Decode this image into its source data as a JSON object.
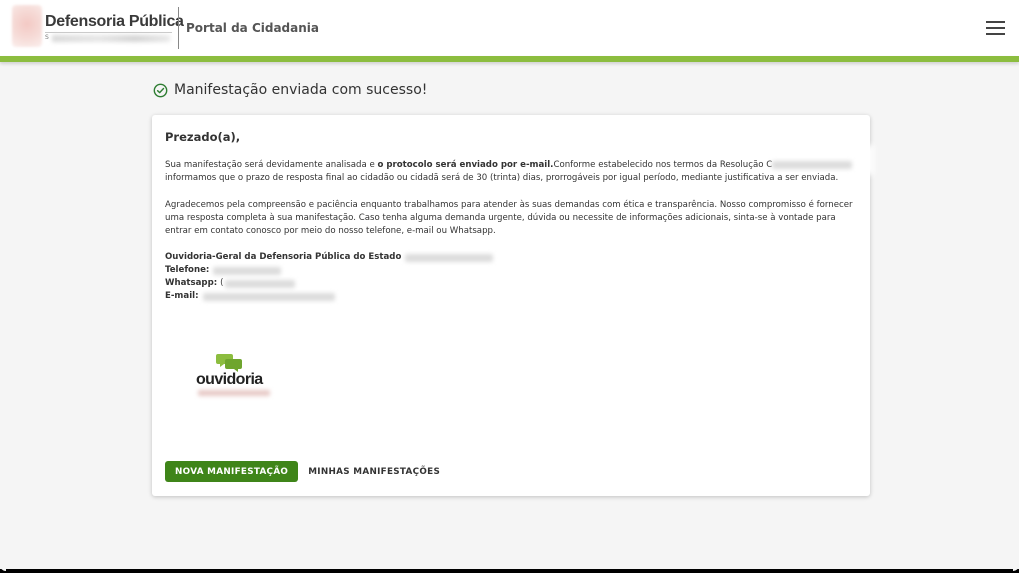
{
  "header": {
    "brand_name": "Defensoria Pública",
    "brand_sub": "S",
    "portal_title": "Portal da Cidadania"
  },
  "status": {
    "success_message": "Manifestação enviada com sucesso!"
  },
  "card": {
    "greeting": "Prezado(a),",
    "paragraph1": {
      "part1": "Sua manifestação será devidamente analisada e ",
      "bold": "o protocolo será enviado por e-mail.",
      "part2": "Conforme estabelecido nos termos da Resolução C",
      "part3": "informamos que o prazo de resposta final ao cidadão ou cidadã será de 30 (trinta) dias, prorrogáveis por igual período, mediante justificativa a ser enviada."
    },
    "paragraph2": "Agradecemos pela compreensão e paciência enquanto trabalhamos para atender às suas demandas com ética e transparência. Nosso compromisso é fornecer uma resposta completa à sua manifestação. Caso tenha alguma demanda urgente, dúvida ou necessite de informações adicionais, sinta-se à vontade para entrar em contato conosco por meio do nosso telefone, e-mail ou Whatsapp.",
    "contact": {
      "org": "Ouvidoria-Geral da Defensoria Pública do Estado",
      "phone_label": "Telefone:",
      "whatsapp_label": "Whatsapp:",
      "whatsapp_prefix": "(",
      "email_label": "E-mail:"
    },
    "logo_text": "ouvidoria"
  },
  "actions": {
    "new_label": "NOVA MANIFESTAÇÃO",
    "mine_label": "MINHAS MANIFESTAÇÕES"
  },
  "colors": {
    "accent_green": "#8cbd3f",
    "button_green": "#3f8519",
    "success_green": "#2e7d32"
  }
}
